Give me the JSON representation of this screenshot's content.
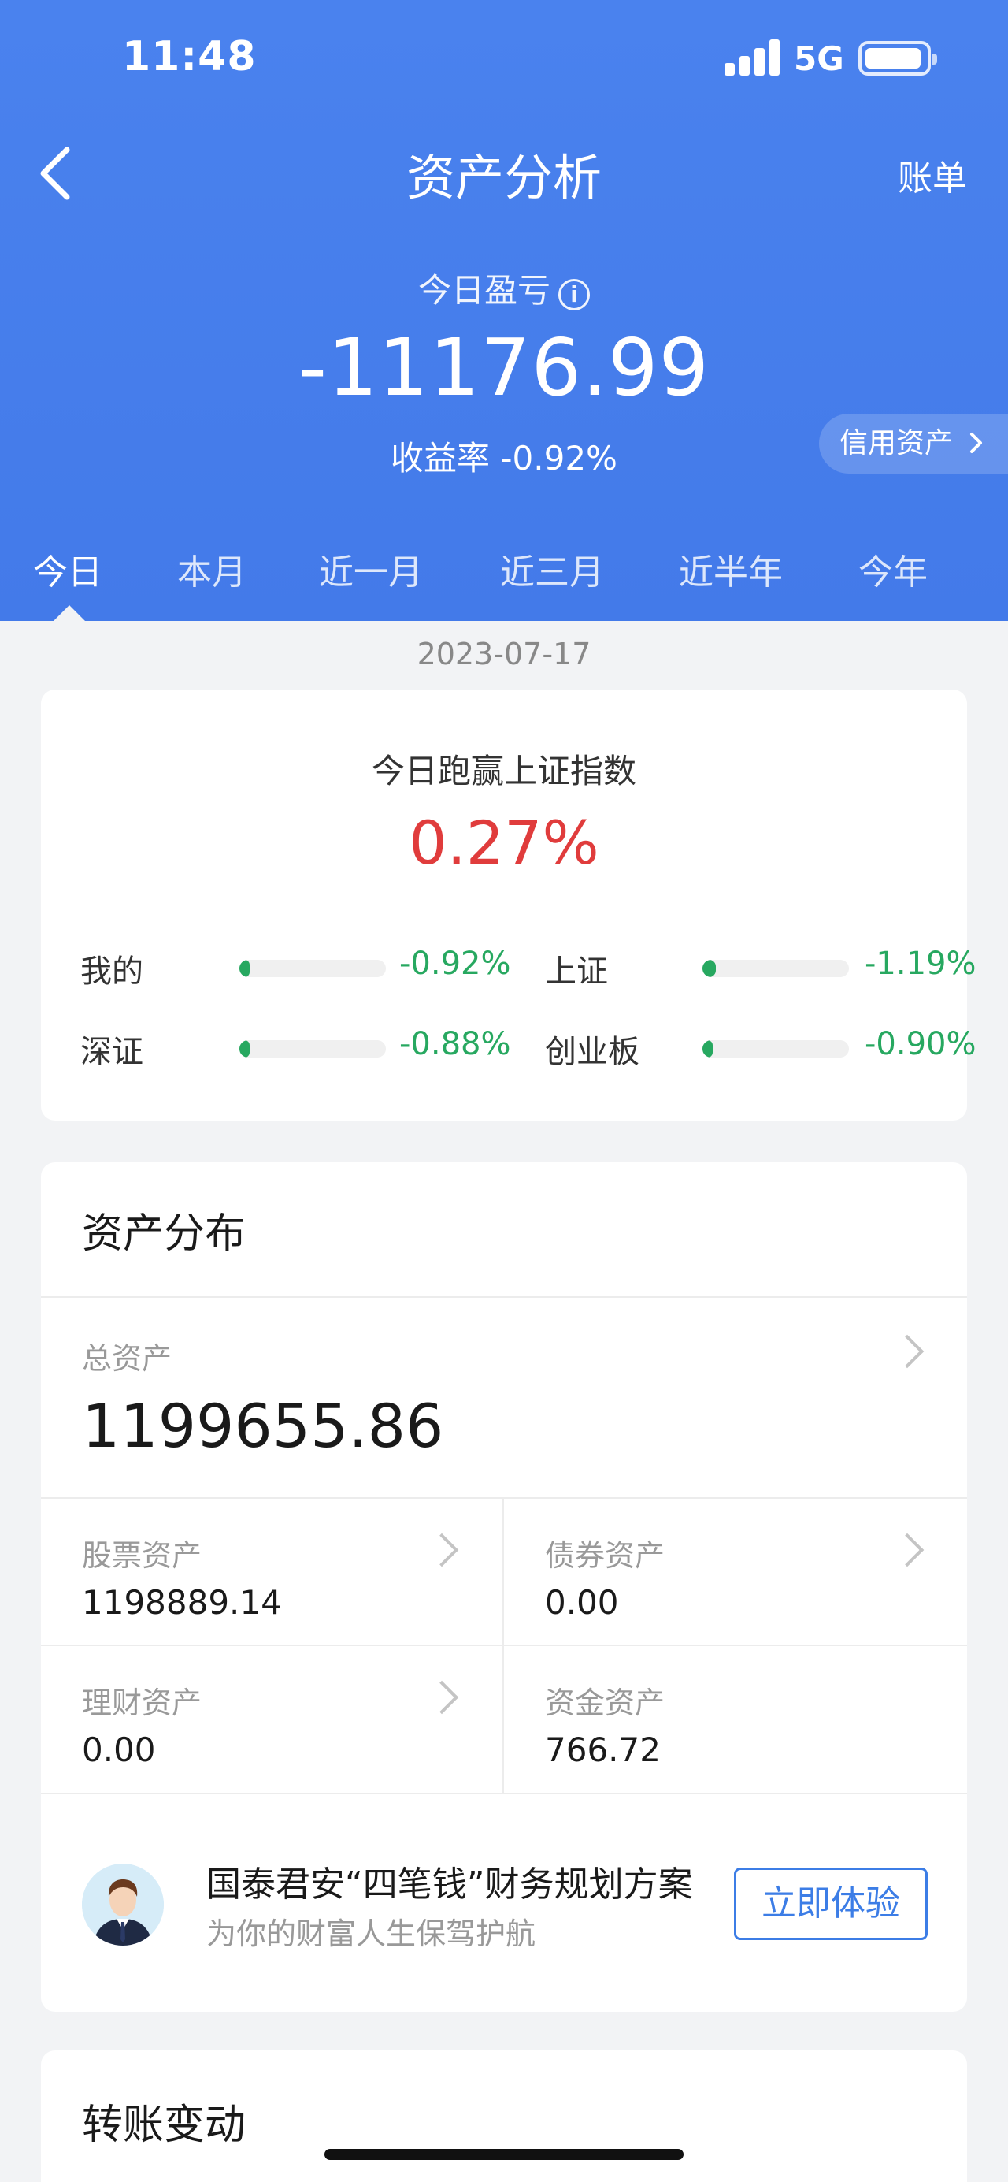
{
  "status_bar": {
    "time": "11:48",
    "network": "5G"
  },
  "nav": {
    "title": "资产分析",
    "right_link": "账单"
  },
  "summary": {
    "pnl_label": "今日盈亏",
    "pnl_value": "-11176.99",
    "yield_text": "收益率 -0.92%",
    "credit_label": "信用资产"
  },
  "tabs": [
    {
      "label": "今日",
      "active": true
    },
    {
      "label": "本月"
    },
    {
      "label": "近一月"
    },
    {
      "label": "近三月"
    },
    {
      "label": "近半年"
    },
    {
      "label": "今年"
    }
  ],
  "date": "2023-07-17",
  "benchmark": {
    "title": "今日跑赢上证指数",
    "value": "0.27%",
    "items": [
      {
        "label": "我的",
        "value": "-0.92%",
        "fill_percent": 7
      },
      {
        "label": "上证",
        "value": "-1.19%",
        "fill_percent": 9
      },
      {
        "label": "深证",
        "value": "-0.88%",
        "fill_percent": 7
      },
      {
        "label": "创业板",
        "value": "-0.90%",
        "fill_percent": 7
      }
    ]
  },
  "distribution": {
    "title": "资产分布",
    "total_label": "总资产",
    "total_value": "1199655.86",
    "items": [
      {
        "label": "股票资产",
        "value": "1198889.14"
      },
      {
        "label": "债券资产",
        "value": "0.00"
      },
      {
        "label": "理财资产",
        "value": "0.00"
      },
      {
        "label": "资金资产",
        "value": "766.72"
      }
    ]
  },
  "promo": {
    "title": "国泰君安“四笔钱”财务规划方案",
    "subtitle": "为你的财富人生保驾护航",
    "button": "立即体验"
  },
  "transfer": {
    "title": "转账变动"
  },
  "colors": {
    "header_blue": "#437ae9",
    "loss_green": "#27a860",
    "gain_red": "#e03c3c",
    "accent": "#3c7de6"
  }
}
